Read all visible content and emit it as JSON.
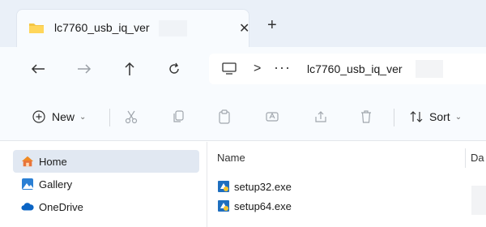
{
  "tab": {
    "title": "lc7760_usb_iq_ver",
    "icon": "folder-icon"
  },
  "nav": {
    "back_icon": "back-arrow-icon",
    "forward_icon": "forward-arrow-icon",
    "up_icon": "up-arrow-icon",
    "refresh_icon": "refresh-icon"
  },
  "address": {
    "separator": ">",
    "overflow": "···",
    "path": "lc7760_usb_iq_ver"
  },
  "toolbar": {
    "new_label": "New",
    "sort_label": "Sort"
  },
  "sidebar": {
    "items": [
      {
        "label": "Home",
        "icon": "home-icon",
        "selected": true
      },
      {
        "label": "Gallery",
        "icon": "gallery-icon"
      },
      {
        "label": "OneDrive",
        "icon": "cloud-icon"
      }
    ]
  },
  "content": {
    "columns": [
      "Name",
      "Da"
    ],
    "files": [
      {
        "name": "setup32.exe",
        "icon": "installer-icon"
      },
      {
        "name": "setup64.exe",
        "icon": "installer-icon"
      }
    ]
  },
  "colors": {
    "accent": "#0067c0",
    "tabbar": "#eaf0f8",
    "selected": "#e1e8f2",
    "folder": "#f4c644"
  }
}
